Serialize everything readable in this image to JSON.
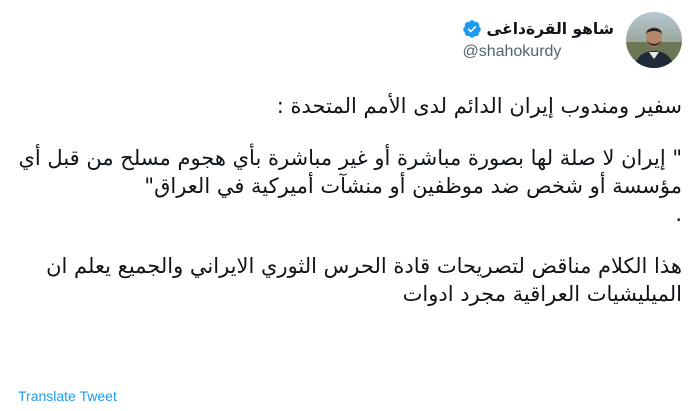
{
  "tweet": {
    "author": {
      "display_name": "شاهو القرةداغی",
      "handle": "@shahokurdy",
      "verified": true,
      "avatar_icon": "profile-photo"
    },
    "more_icon": "more-options-icon",
    "text_paragraphs": [
      "سفير ومندوب إيران الدائم لدى الأمم المتحدة :",
      "\" إيران لا صلة لها بصورة مباشرة أو غير مباشرة بأي هجوم مسلح من قبل أي مؤسسة أو شخص ضد موظفين أو منشآت أميركية في العراق\"",
      ".",
      "هذا الكلام مناقض لتصريحات قادة الحرس الثوري الايراني والجميع يعلم ان الميليشيات العراقية مجرد ادوات"
    ],
    "translate_label": "Translate Tweet"
  },
  "colors": {
    "text": "#0f1419",
    "secondary": "#536471",
    "accent": "#1d9bf0"
  }
}
